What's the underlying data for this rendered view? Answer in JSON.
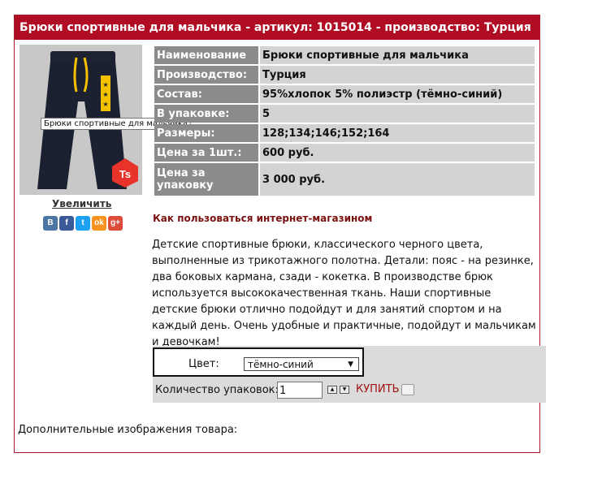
{
  "header": {
    "title": "Брюки спортивные для мальчика - артикул: 1015014 - производство: Турция"
  },
  "photo": {
    "tooltip": "Брюки спортивные для мальчика",
    "badge": "Ts"
  },
  "zoom": {
    "label": "Увеличить"
  },
  "social": [
    {
      "icon": "vkontakte-icon",
      "glyph": "В",
      "color": "#4c75a3"
    },
    {
      "icon": "facebook-icon",
      "glyph": "f",
      "color": "#3b5998"
    },
    {
      "icon": "twitter-icon",
      "glyph": "t",
      "color": "#1da1f2"
    },
    {
      "icon": "odnoklassniki-icon",
      "glyph": "ok",
      "color": "#f7931e"
    },
    {
      "icon": "googleplus-icon",
      "glyph": "g+",
      "color": "#dd4b39"
    }
  ],
  "specs": [
    {
      "key": "Наименование",
      "value": "Брюки спортивные для мальчика"
    },
    {
      "key": "Производство:",
      "value": "Турция"
    },
    {
      "key": "Состав:",
      "value": "95%хлопок 5% полиэстр (тёмно-синий)"
    },
    {
      "key": "В упаковке:",
      "value": "5"
    },
    {
      "key": "Размеры:",
      "value": "128;134;146;152;164"
    },
    {
      "key": "Цена за 1шт.:",
      "value": "600 руб."
    },
    {
      "key": "Цена за упаковку",
      "value": "3 000 руб."
    }
  ],
  "howto": {
    "label": "Как пользоваться интернет-магазином"
  },
  "description": "Детские спортивные брюки, классического черного цвета, выполненные из трикотажного полотна. Детали: пояс - на резинке, два боковых кармана, сзади - кокетка. В производстве брюк используется высококачественная ткань. Наши спортивные детские брюки отлично подойдут и для занятий спортом и на каждый день. Очень удобные и практичные, подойдут и мальчикам и девочкам!",
  "buy": {
    "color_label": "Цвет:",
    "color_value": "тёмно-синий",
    "qty_label": "Количество упаковок:",
    "qty_value": "1",
    "buy_label": "КУПИТЬ"
  },
  "extra": {
    "label": "Дополнительные изображения товара:"
  },
  "colors": {
    "brand": "#b00d24",
    "key_cell": "#8b8b8b",
    "value_cell": "#d3d3d3"
  }
}
